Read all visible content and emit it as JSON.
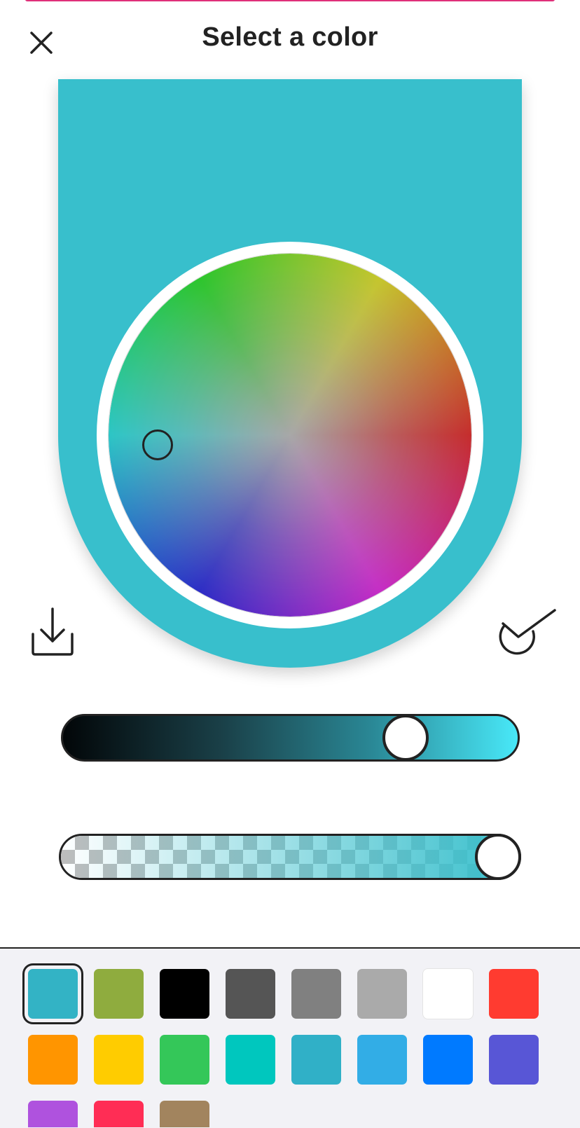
{
  "header": {
    "title": "Select a color",
    "close_icon": "close-icon"
  },
  "selected_color": "#38BFCC",
  "color_wheel": {
    "selected_hue_deg": 186,
    "selected_saturation": 0.73
  },
  "brightness_slider": {
    "value": 0.78,
    "gradient_end_color": "#48E8F8"
  },
  "opacity_slider": {
    "value": 1.0
  },
  "actions": {
    "download_icon": "download-icon",
    "confirm_icon": "checkmark-icon"
  },
  "palette": {
    "selected_index": 0,
    "swatches": [
      "#33B3C5",
      "#8FAC3E",
      "#000000",
      "#555555",
      "#808080",
      "#AAAAAA",
      "#FFFFFF",
      "#FF3B30",
      "#FF9500",
      "#FFCC00",
      "#34C759",
      "#00C7BE",
      "#30B0C7",
      "#32ADE6",
      "#007AFF",
      "#5856D6",
      "#AF52DE",
      "#FF2D55",
      "#A2845E"
    ]
  }
}
